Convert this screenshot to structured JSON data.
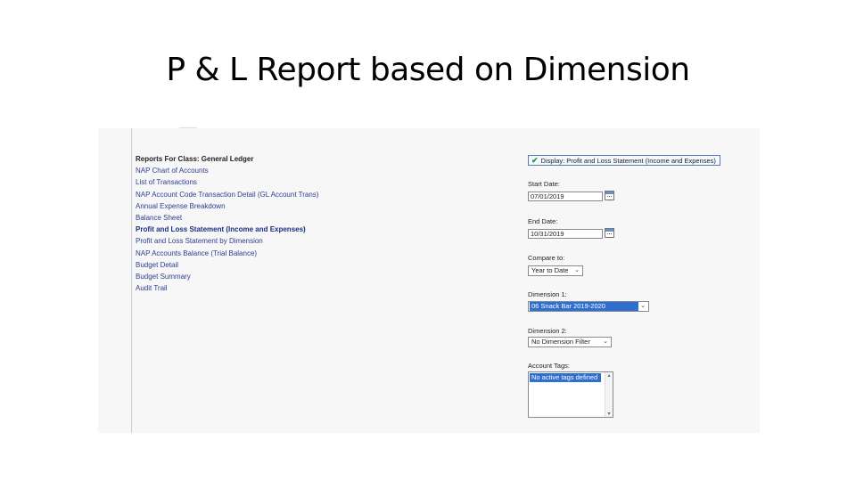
{
  "slide_title": "P & L Report based on Dimension",
  "reports": {
    "heading": "Reports For Class: General Ledger",
    "items": [
      "NAP Chart of Accounts",
      "List of Transactions",
      "NAP Account Code Transaction Detail (GL Account Trans)",
      "Annual Expense Breakdown",
      "Balance Sheet",
      "Profit and Loss Statement (Income and Expenses)",
      "Profit and Loss Statement by Dimension",
      "NAP Accounts Balance (Trial Balance)",
      "Budget Detail",
      "Budget Summary",
      "Audit Trail"
    ]
  },
  "form": {
    "display_button": "Display: Profit and Loss Statement (Income and Expenses)",
    "start_date_label": "Start Date:",
    "start_date_value": "07/01/2019",
    "end_date_label": "End Date:",
    "end_date_value": "10/31/2019",
    "compare_label": "Compare to:",
    "compare_value": "Year to Date",
    "dimension1_label": "Dimension 1:",
    "dimension1_value": "06 Snack Bar 2019-2020",
    "dimension2_label": "Dimension 2:",
    "dimension2_value": "No Dimension Filter",
    "account_tags_label": "Account Tags:",
    "account_tags_value": "No active tags defined"
  },
  "colors": {
    "link": "#2b3f8f",
    "selection": "#2e6fd1",
    "check": "#1f9d2c"
  }
}
